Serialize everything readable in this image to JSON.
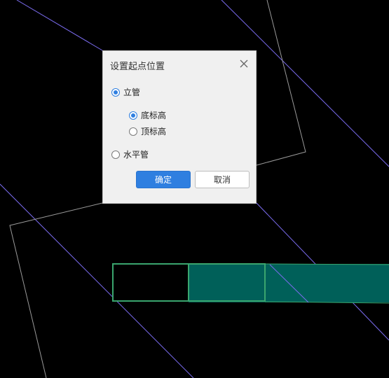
{
  "dialog": {
    "title": "设置起点位置",
    "close_icon": "close-icon",
    "options": {
      "vertical_pipe": {
        "label": "立管",
        "checked": true
      },
      "bottom_elevation": {
        "label": "底标高",
        "checked": true
      },
      "top_elevation": {
        "label": "顶标高",
        "checked": false
      },
      "horizontal_pipe": {
        "label": "水平管",
        "checked": false
      }
    },
    "confirm_label": "确定",
    "cancel_label": "取消"
  },
  "colors": {
    "background": "#000000",
    "guide_line": "#7b6cf0",
    "outline": "#9a9a9a",
    "pipe_fill": "#006059",
    "pipe_border": "#3aa56e",
    "primary_button": "#2f7fe0"
  }
}
